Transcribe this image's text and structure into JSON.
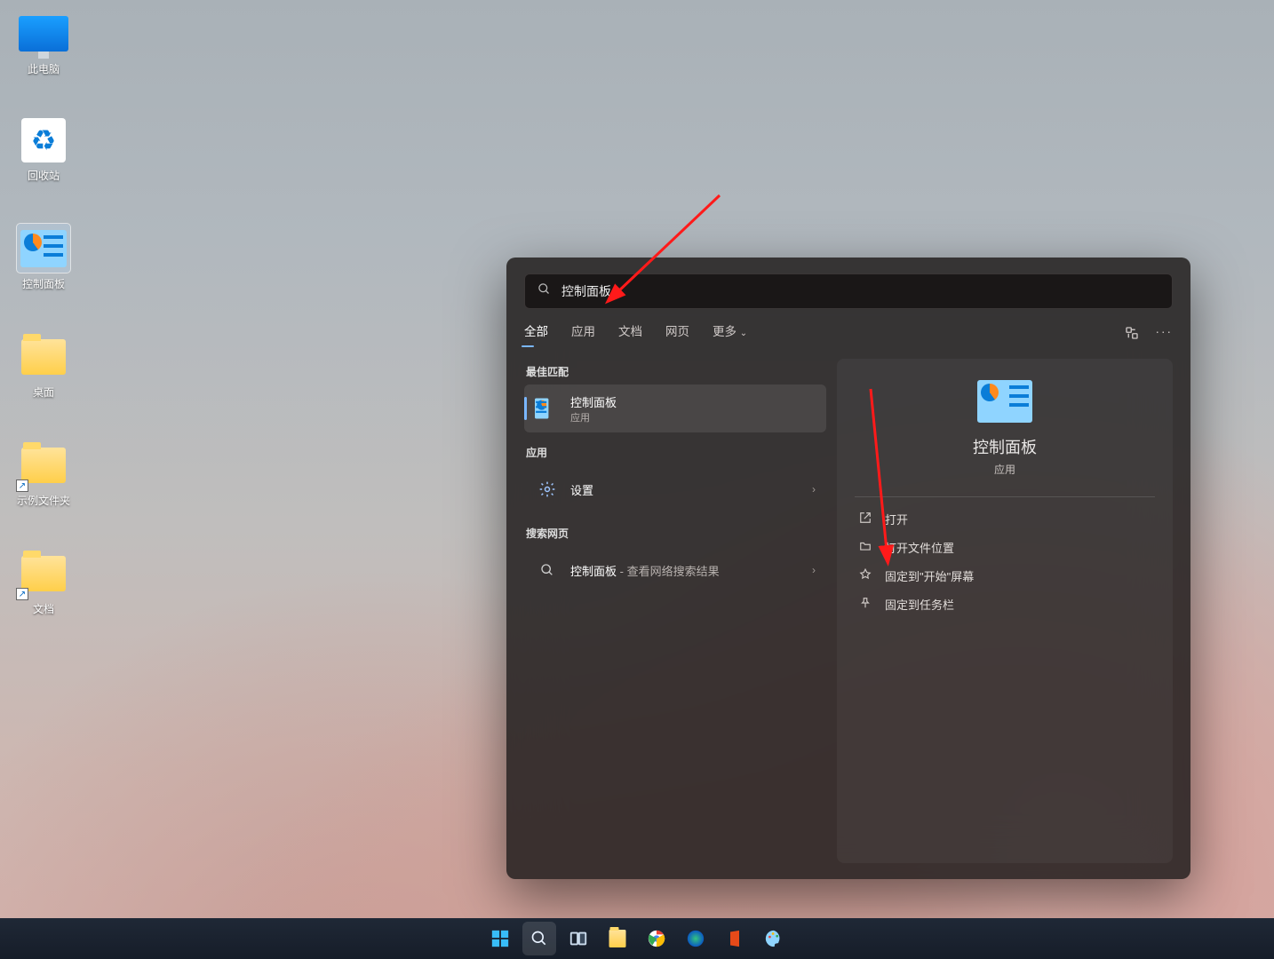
{
  "desktop_icons": [
    {
      "id": "this-pc",
      "label": "此电脑"
    },
    {
      "id": "recycle-bin",
      "label": "回收站"
    },
    {
      "id": "control-panel",
      "label": "控制面板",
      "selected": true
    },
    {
      "id": "desktop-folder",
      "label": "桌面",
      "shortcut": false
    },
    {
      "id": "demo-folder",
      "label": "示例文件夹",
      "shortcut": true
    },
    {
      "id": "docs-folder",
      "label": "文档",
      "shortcut": true
    }
  ],
  "search": {
    "query": "控制面板",
    "tabs": [
      "全部",
      "应用",
      "文档",
      "网页"
    ],
    "more": "更多",
    "active_tab": 0,
    "sections": {
      "best_match": "最佳匹配",
      "apps": "应用",
      "web": "搜索网页"
    },
    "results": {
      "best": {
        "title": "控制面板",
        "subtitle": "应用"
      },
      "app": {
        "title": "设置"
      },
      "web": {
        "title": "控制面板",
        "suffix": " - 查看网络搜索结果"
      }
    },
    "preview": {
      "title": "控制面板",
      "subtitle": "应用",
      "actions": [
        "打开",
        "打开文件位置",
        "固定到\"开始\"屏幕",
        "固定到任务栏"
      ]
    }
  },
  "taskbar": {
    "items": [
      "start",
      "search",
      "taskview",
      "explorer",
      "chrome",
      "edge",
      "office",
      "paint"
    ]
  }
}
